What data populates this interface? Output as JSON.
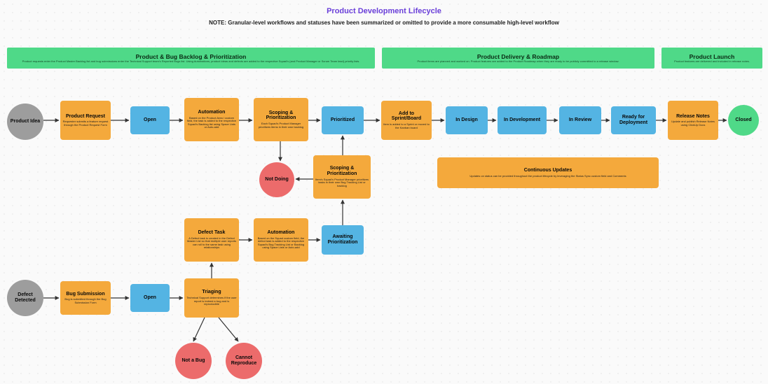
{
  "title": "Product Development Lifecycle",
  "note": "NOTE: Granular-level workflows and statuses have been summarized or omitted to provide a more consumable high-level workflow",
  "bands": {
    "backlog": {
      "title": "Product & Bug Backlog & Prioritization",
      "sub": "Product requests enter the Product Master Backlog list and bug submissions enter the Technical Support team's Reported Bugs list. Using Automations, product ideas and defects are added to the respective Squad's (and Product Manager or Scrum Team lead) priority lists."
    },
    "delivery": {
      "title": "Product Delivery & Roadmap",
      "sub": "Product items are planned and worked on. Product features are added to the Product Roadmap when they are ready to be publicly committed to a release window."
    },
    "launch": {
      "title": "Product Launch",
      "sub": "Product features are delivered and included in release notes."
    }
  },
  "start": {
    "productIdea": "Product Idea",
    "defectDetected": "Defect Detected"
  },
  "row1": {
    "productRequest": {
      "t": "Product Request",
      "s": "Requester submits a feature request through the Product Request Form"
    },
    "open1": {
      "t": "Open"
    },
    "automation1": {
      "t": "Automation",
      "s": "Based on the Product Area / custom field, the task is added to the respective Squad's Backlog list using Space Lists or Auto-add"
    },
    "scoping1": {
      "t": "Scoping & Prioritization",
      "s": "Each Squad's Product Manager prioritizes items in their own backlog"
    },
    "prioritized": {
      "t": "Prioritized"
    },
    "addSprint": {
      "t": "Add to Sprint/Board",
      "s": "Item is added to a Sprint or moved to the Kanban board"
    },
    "inDesign": {
      "t": "In Design"
    },
    "inDev": {
      "t": "In Development"
    },
    "inReview": {
      "t": "In Review"
    },
    "readyDeploy": {
      "t": "Ready for Deployment"
    },
    "releaseNotes": {
      "t": "Release Notes",
      "s": "Update and publish Release Notes using ClickUp Docs"
    },
    "closed": {
      "t": "Closed"
    }
  },
  "mid": {
    "notDoing": {
      "t": "Not Doing"
    },
    "scoping2": {
      "t": "Scoping & Prioritization",
      "s": "Item's Squad's Product Manager prioritizes tasks in their own Bug Tracking List or backlog"
    },
    "contUpdates": {
      "t": "Continuous Updates",
      "s": "Updates on status can be provided throughout the product lifecycle by leveraging the Status Sync custom field and Comments"
    }
  },
  "row3": {
    "defectTask": {
      "t": "Defect Task",
      "s": "A Defect task is created in the Defect Master List so that multiple user reports can roll to the same task using relationships"
    },
    "automation2": {
      "t": "Automation",
      "s": "Based on the Squad custom field, the defect task is added to the respective Squad's Bug Tracking List or Backlog using Space Lists or Auto-add"
    },
    "awaitPrior": {
      "t": "Awaiting Prioritization"
    }
  },
  "row4": {
    "bugSubmission": {
      "t": "Bug Submission",
      "s": "Bug is submitted through the Bug Submission Form"
    },
    "open2": {
      "t": "Open"
    },
    "triaging": {
      "t": "Triaging",
      "s": "Technical Support determines if the user report is indeed a bug and is reproducible"
    }
  },
  "bottom": {
    "notABug": {
      "t": "Not a Bug"
    },
    "cannotRepro": {
      "t": "Cannot Reproduce"
    }
  }
}
